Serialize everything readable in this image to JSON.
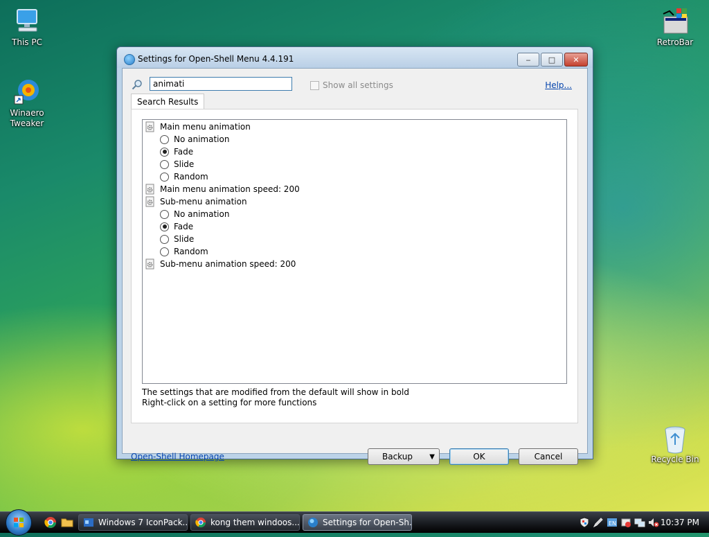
{
  "desktop": {
    "icons": [
      {
        "label": "This PC",
        "icon": "computer-icon"
      },
      {
        "label": "Winaero Tweaker",
        "label_line1": "Winaero",
        "label_line2": "Tweaker",
        "icon": "winaero-tweaker-icon"
      },
      {
        "label": "RetroBar",
        "icon": "retrobar-icon"
      },
      {
        "label": "Recycle Bin",
        "icon": "recycle-bin-icon"
      }
    ]
  },
  "window": {
    "title": "Settings for Open-Shell Menu 4.4.191",
    "search": {
      "value": "animati",
      "placeholder": ""
    },
    "show_all_settings": {
      "label": "Show all settings",
      "checked": false,
      "enabled": false
    },
    "help_link": "Help...",
    "tab_label": "Search Results",
    "tree": [
      {
        "type": "group",
        "label": "Main menu animation"
      },
      {
        "type": "radio",
        "label": "No animation",
        "checked": false
      },
      {
        "type": "radio",
        "label": "Fade",
        "checked": true
      },
      {
        "type": "radio",
        "label": "Slide",
        "checked": false
      },
      {
        "type": "radio",
        "label": "Random",
        "checked": false
      },
      {
        "type": "setting",
        "label": "Main menu animation speed: 200"
      },
      {
        "type": "group",
        "label": "Sub-menu animation"
      },
      {
        "type": "radio",
        "label": "No animation",
        "checked": false
      },
      {
        "type": "radio",
        "label": "Fade",
        "checked": true
      },
      {
        "type": "radio",
        "label": "Slide",
        "checked": false
      },
      {
        "type": "radio",
        "label": "Random",
        "checked": false
      },
      {
        "type": "setting",
        "label": "Sub-menu animation speed: 200"
      }
    ],
    "notes": [
      "The settings that are modified from the default will show in bold",
      "Right-click on a setting for more functions"
    ],
    "homepage_link": "Open-Shell Homepage",
    "buttons": {
      "backup": "Backup",
      "ok": "OK",
      "cancel": "Cancel"
    }
  },
  "taskbar": {
    "tasks": [
      {
        "label": "Windows 7 IconPack...",
        "icon": "iconpack-icon",
        "active": false
      },
      {
        "label": "kong them windoos...",
        "icon": "chrome-icon",
        "active": false
      },
      {
        "label": "Settings for Open-Sh...",
        "icon": "open-shell-icon",
        "active": true
      }
    ],
    "clock": "10:37 PM"
  },
  "colors": {
    "link": "#0645ad",
    "title_bar": "#bcd3e8",
    "close_button": "#c4412f"
  }
}
